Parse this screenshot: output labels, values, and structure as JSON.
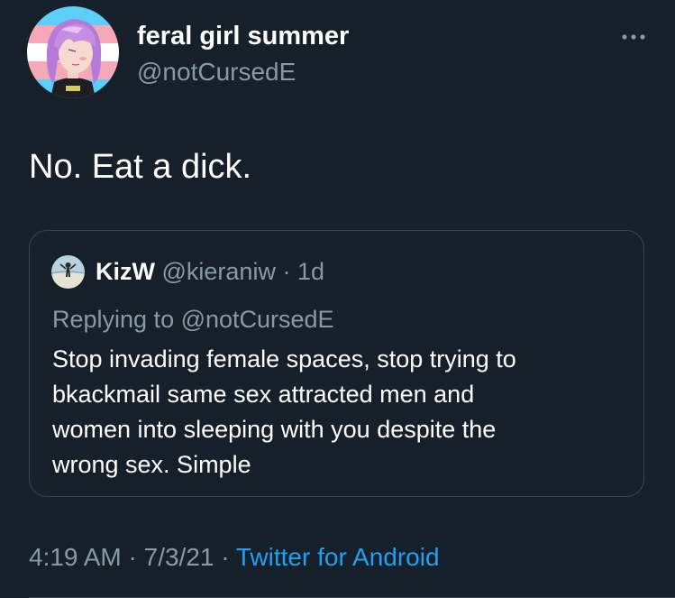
{
  "author": {
    "name": "feral girl summer",
    "handle": "@notCursedE",
    "avatar_icon": "user-avatar"
  },
  "tweet": {
    "text": "No. Eat a dick."
  },
  "quoted_tweet": {
    "name": "KizW",
    "handle": "@kieraniw",
    "separator": "·",
    "time": "1d",
    "replying_to": "Replying to @notCursedE",
    "text_lines": [
      "Stop invading female spaces, stop trying to",
      "bkackmail same sex attracted men and",
      "women into sleeping with you despite the",
      "wrong sex. Simple"
    ]
  },
  "footer": {
    "time": "4:19 AM",
    "separator": "·",
    "date": "7/3/21",
    "source": "Twitter for Android"
  },
  "icons": {
    "more": "more-icon"
  },
  "colors": {
    "background": "#15202b",
    "text_primary": "#ffffff",
    "text_secondary": "#8899a6",
    "accent": "#1da1f2",
    "border": "#38444d"
  }
}
